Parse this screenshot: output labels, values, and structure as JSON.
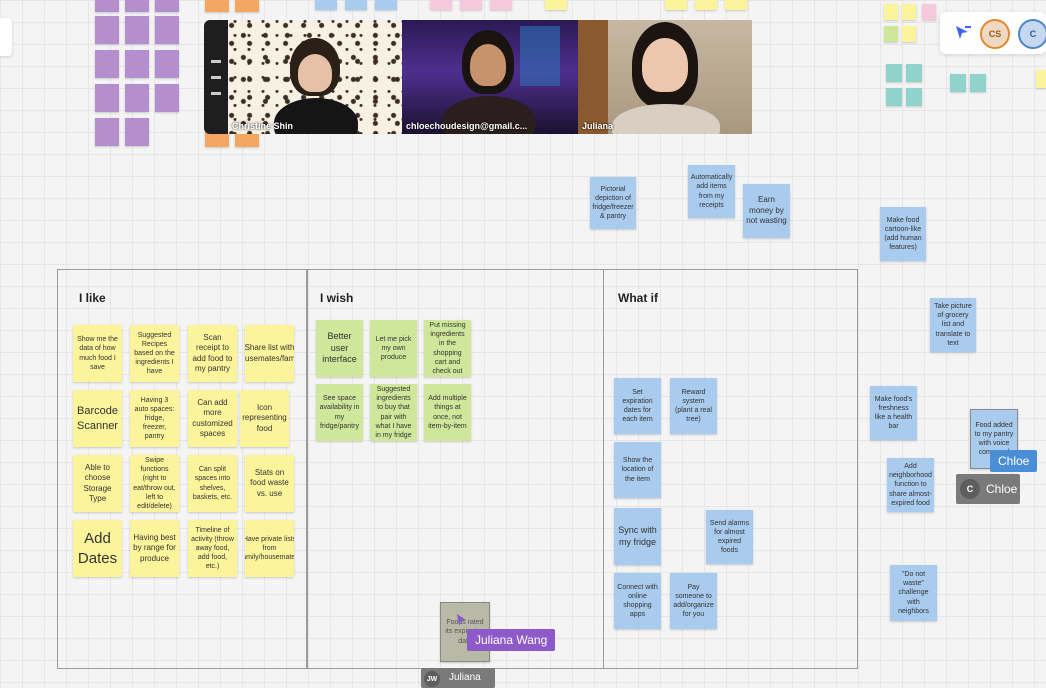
{
  "video_call": {
    "participants": [
      {
        "name": "Christine Shin"
      },
      {
        "name": "chloechoudesign@gmail.c..."
      },
      {
        "name": "Juliana"
      }
    ]
  },
  "presence": {
    "avatars": [
      {
        "initials": "CS",
        "color": "#e08a2e"
      },
      {
        "initials": "C",
        "color": "#4a86c8"
      }
    ]
  },
  "floating_notes": {
    "pictorial": "Pictorial depiction of fridge/freezer & pantry",
    "auto_add": "Automatically add items from my receipts",
    "earn_money": "Earn money by not wasting",
    "cartoon": "Make food cartoon-like (add human features)",
    "take_picture": "Take picture of grocery list and translate to text",
    "freshness": "Make food's freshness like a health bar",
    "voice": "Food added to my pantry with voice command",
    "neighborhood": "Add neighborhood function to share almost-expired food",
    "do_not_waste": "\"Do not waste\" challenge with neighbors",
    "dragged": "Foods rated its expiration date"
  },
  "frames": {
    "like": {
      "title": "I like",
      "notes": [
        "Show me the data of how much food I save",
        "Suggested Recipes based on the ingredients I have",
        "Scan receipt to add food to my pantry",
        "Share list with housemates/family",
        "Barcode Scanner",
        "Having 3 auto spaces: fridge, freezer, pantry",
        "Can add more customized spaces",
        "Icon representing food",
        "Able to choose Storage Type",
        "Swipe functions (right to eat/throw out, left to edit/delete)",
        "Can split spaces into shelves, baskets, etc.",
        "Stats on food waste vs. use",
        "Add Dates",
        "Having best by range for produce",
        "Timeline of activity (throw away food, add food, etc.)",
        "Have private lists from family/housemates"
      ]
    },
    "wish": {
      "title": "I wish",
      "notes": [
        "Better user interface",
        "Let me pick my own produce",
        "Put missing ingredients in the shopping cart and check out",
        "See space availability in my fridge/pantry",
        "Suggested ingredients to buy that pair with what I have in my fridge",
        "Add multiple things at once, not item-by-item"
      ]
    },
    "whatif": {
      "title": "What if",
      "notes": [
        "Set expiration dates for each item",
        "Reward system (plant a real tree)",
        "Show the location of the item",
        "Sync with my fridge",
        "Send alarms for almost expired foods",
        "Connect with online shopping apps",
        "Pay someone to add/organize for you"
      ]
    }
  },
  "cursors": {
    "chloe": {
      "label": "Chloe",
      "tag": "Chloe",
      "initial": "C"
    },
    "juliana": {
      "label": "Juliana Wang",
      "tag": "Juliana",
      "initials": "JW"
    }
  }
}
